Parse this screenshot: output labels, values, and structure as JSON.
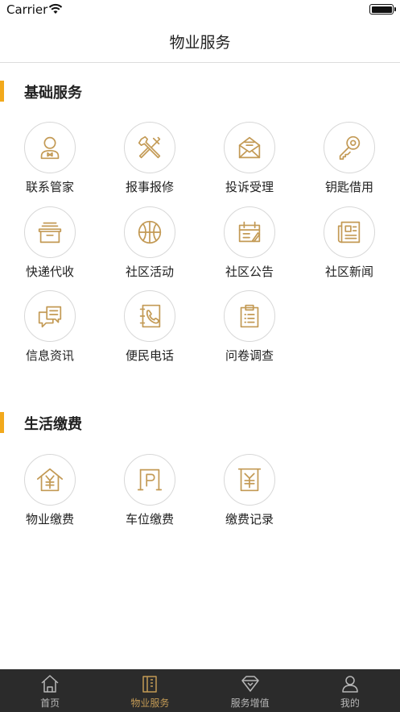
{
  "status_bar": {
    "carrier": "Carrier"
  },
  "header": {
    "title": "物业服务"
  },
  "sections": [
    {
      "title": "基础服务",
      "items": [
        {
          "label": "联系管家",
          "icon": "butler-icon"
        },
        {
          "label": "报事报修",
          "icon": "tools-icon"
        },
        {
          "label": "投诉受理",
          "icon": "mail-icon"
        },
        {
          "label": "钥匙借用",
          "icon": "key-icon"
        },
        {
          "label": "快递代收",
          "icon": "parcel-icon"
        },
        {
          "label": "社区活动",
          "icon": "basketball-icon"
        },
        {
          "label": "社区公告",
          "icon": "notice-icon"
        },
        {
          "label": "社区新闻",
          "icon": "news-icon"
        },
        {
          "label": "信息资讯",
          "icon": "message-icon"
        },
        {
          "label": "便民电话",
          "icon": "phone-book-icon"
        },
        {
          "label": "问卷调查",
          "icon": "clipboard-icon"
        }
      ]
    },
    {
      "title": "生活缴费",
      "items": [
        {
          "label": "物业缴费",
          "icon": "house-yuan-icon"
        },
        {
          "label": "车位缴费",
          "icon": "parking-icon"
        },
        {
          "label": "缴费记录",
          "icon": "receipt-yuan-icon"
        }
      ]
    }
  ],
  "tab_bar": {
    "tabs": [
      {
        "label": "首页",
        "icon": "home-icon",
        "active": false
      },
      {
        "label": "物业服务",
        "icon": "building-icon",
        "active": true
      },
      {
        "label": "服务增值",
        "icon": "diamond-icon",
        "active": false
      },
      {
        "label": "我的",
        "icon": "user-icon",
        "active": false
      }
    ]
  },
  "colors": {
    "accent": "#f2a91c",
    "icon_gold": "#c39a55",
    "tab_bar_bg": "#2b2b2b",
    "tab_inactive": "#b8b8b8"
  }
}
